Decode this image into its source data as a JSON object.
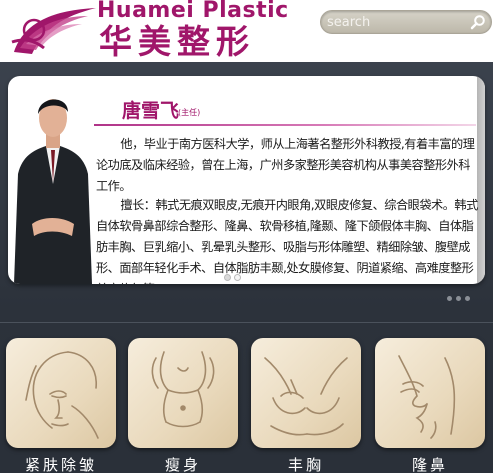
{
  "header": {
    "brand_en": "Huamei Plastic",
    "brand_cn": "华美整形",
    "search_placeholder": "search"
  },
  "doctor": {
    "name": "唐雪飞",
    "title": "(主任)",
    "bio": "他，毕业于南方医科大学，师从上海著名整形外科教授,有着丰富的理论功底及临床经验，曾在上海，广州多家整形美容机构从事美容整形外科工作。",
    "specialty": "擅长：韩式无痕双眼皮,无痕开内眼角,双眼皮修复、综合眼袋术。韩式自体软骨鼻部综合整形、隆鼻、软骨移植,隆颞、隆下颌假体丰胸、自体脂肪丰胸、巨乳缩小、乳晕乳头整形、吸脂与形体雕塑、精细除皱、腹壁成形、面部年轻化手术、自体脂肪丰颞,处女膜修复、阴道紧缩、高难度整形美容修复等。"
  },
  "carousel": {
    "slide_count": 2,
    "active_index": 0
  },
  "categories": [
    {
      "label": "紧肤除皱",
      "icon": "face-wrinkle-icon"
    },
    {
      "label": "瘦身",
      "icon": "body-slim-icon"
    },
    {
      "label": "丰胸",
      "icon": "breast-icon"
    },
    {
      "label": "隆鼻",
      "icon": "nose-profile-icon"
    }
  ],
  "colors": {
    "brand": "#a0166a",
    "background": "#2e343d",
    "tile": "#ecdcc0"
  }
}
